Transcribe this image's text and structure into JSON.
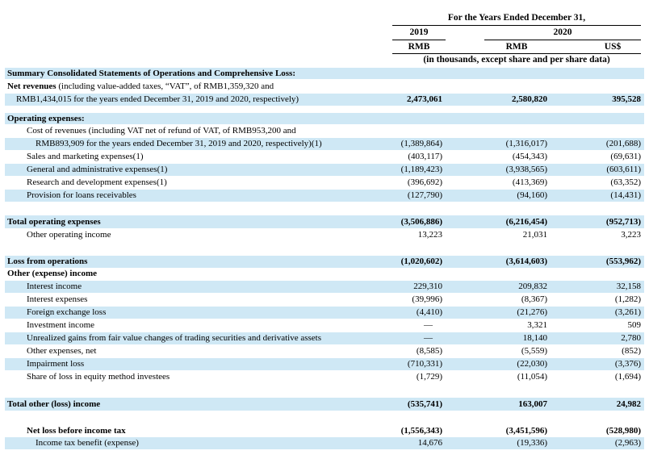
{
  "header": {
    "period_title": "For the Years Ended December 31,",
    "year_2019": "2019",
    "year_2020": "2020",
    "cur_rmb_2019": "RMB",
    "cur_rmb_2020": "RMB",
    "cur_usd": "US$",
    "units_note": "(in thousands, except share and per share data)"
  },
  "rows": [
    {
      "label": "Summary Consolidated Statements of Operations and Comprehensive Loss:",
      "v2019": "",
      "v2020": "",
      "usd": ""
    },
    {
      "label": "Net revenues",
      "label_suffix": " (including value-added taxes, “VAT”, of RMB1,359,320 and",
      "v2019": "",
      "v2020": "",
      "usd": ""
    },
    {
      "label": "RMB1,434,015 for the years ended December 31, 2019 and 2020, respectively)",
      "v2019": "2,473,061",
      "v2020": "2,580,820",
      "usd": "395,528"
    },
    {
      "label": "Operating expenses:",
      "v2019": "",
      "v2020": "",
      "usd": ""
    },
    {
      "label": "Cost of revenues (including VAT net of refund of VAT, of RMB953,200 and",
      "v2019": "",
      "v2020": "",
      "usd": ""
    },
    {
      "label": "RMB893,909 for the years ended December 31, 2019 and 2020, respectively)(1)",
      "v2019": "(1,389,864)",
      "v2020": "(1,316,017)",
      "usd": "(201,688)"
    },
    {
      "label": "Sales and marketing expenses(1)",
      "v2019": "(403,117)",
      "v2020": "(454,343)",
      "usd": "(69,631)"
    },
    {
      "label": "General and administrative expenses(1)",
      "v2019": "(1,189,423)",
      "v2020": "(3,938,565)",
      "usd": "(603,611)"
    },
    {
      "label": "Research and development expenses(1)",
      "v2019": "(396,692)",
      "v2020": "(413,369)",
      "usd": "(63,352)"
    },
    {
      "label": "Provision for loans receivables",
      "v2019": "(127,790)",
      "v2020": "(94,160)",
      "usd": "(14,431)"
    },
    {
      "label": "Total operating expenses",
      "v2019": "(3,506,886)",
      "v2020": "(6,216,454)",
      "usd": "(952,713)"
    },
    {
      "label": "Other operating income",
      "v2019": "13,223",
      "v2020": "21,031",
      "usd": "3,223"
    },
    {
      "label": "Loss from operations",
      "v2019": "(1,020,602)",
      "v2020": "(3,614,603)",
      "usd": "(553,962)"
    },
    {
      "label": "Other (expense) income",
      "v2019": "",
      "v2020": "",
      "usd": ""
    },
    {
      "label": "Interest income",
      "v2019": "229,310",
      "v2020": "209,832",
      "usd": "32,158"
    },
    {
      "label": "Interest expenses",
      "v2019": "(39,996)",
      "v2020": "(8,367)",
      "usd": "(1,282)"
    },
    {
      "label": "Foreign exchange loss",
      "v2019": "(4,410)",
      "v2020": "(21,276)",
      "usd": "(3,261)"
    },
    {
      "label": "Investment income",
      "v2019": "—",
      "v2020": "3,321",
      "usd": "509"
    },
    {
      "label": "Unrealized gains from fair value changes of trading securities and derivative assets",
      "v2019": "—",
      "v2020": "18,140",
      "usd": "2,780"
    },
    {
      "label": "Other expenses, net",
      "v2019": "(8,585)",
      "v2020": "(5,559)",
      "usd": "(852)"
    },
    {
      "label": "Impairment loss",
      "v2019": "(710,331)",
      "v2020": "(22,030)",
      "usd": "(3,376)"
    },
    {
      "label": "Share of loss in equity method investees",
      "v2019": "(1,729)",
      "v2020": "(11,054)",
      "usd": "(1,694)"
    },
    {
      "label": "Total other (loss) income",
      "v2019": "(535,741)",
      "v2020": "163,007",
      "usd": "24,982"
    },
    {
      "label": "Net loss before income tax",
      "v2019": "(1,556,343)",
      "v2020": "(3,451,596)",
      "usd": "(528,980)"
    },
    {
      "label": "Income tax benefit (expense)",
      "v2019": "14,676",
      "v2020": "(19,336)",
      "usd": "(2,963)"
    }
  ]
}
